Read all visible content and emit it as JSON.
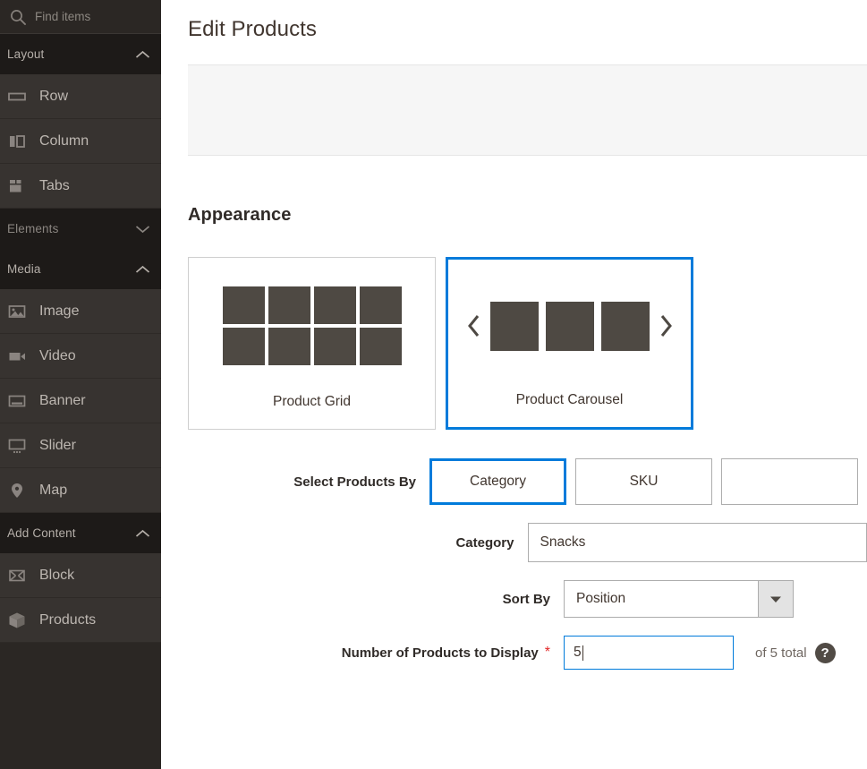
{
  "sidebar": {
    "search": {
      "placeholder": "Find items",
      "value": "",
      "icon": "search-icon"
    },
    "sections": [
      {
        "key": "layout",
        "label": "Layout",
        "expanded": true,
        "chevron": "chevron-up-icon",
        "items": [
          {
            "label": "Row",
            "icon": "row-icon"
          },
          {
            "label": "Column",
            "icon": "column-icon"
          },
          {
            "label": "Tabs",
            "icon": "tabs-icon"
          }
        ]
      },
      {
        "key": "elements",
        "label": "Elements",
        "expanded": false,
        "chevron": "chevron-down-icon",
        "items": []
      },
      {
        "key": "media",
        "label": "Media",
        "expanded": true,
        "chevron": "chevron-up-icon",
        "items": [
          {
            "label": "Image",
            "icon": "image-icon"
          },
          {
            "label": "Video",
            "icon": "video-icon"
          },
          {
            "label": "Banner",
            "icon": "banner-icon"
          },
          {
            "label": "Slider",
            "icon": "slider-icon"
          },
          {
            "label": "Map",
            "icon": "map-pin-icon"
          }
        ]
      },
      {
        "key": "add_content",
        "label": "Add Content",
        "expanded": true,
        "chevron": "chevron-up-icon",
        "items": [
          {
            "label": "Block",
            "icon": "block-icon"
          },
          {
            "label": "Products",
            "icon": "products-box-icon"
          }
        ]
      }
    ]
  },
  "main": {
    "page_title": "Edit Products",
    "appearance": {
      "title": "Appearance",
      "options": [
        {
          "label": "Product Grid",
          "art": "grid",
          "selected": false
        },
        {
          "label": "Product Carousel",
          "art": "carousel",
          "selected": true
        }
      ]
    },
    "form": {
      "select_products_by": {
        "label": "Select Products By",
        "options": [
          {
            "label": "Category",
            "selected": true
          },
          {
            "label": "SKU",
            "selected": false
          },
          {
            "label": "",
            "selected": false
          }
        ]
      },
      "category": {
        "label": "Category",
        "value": "Snacks",
        "placeholder": ""
      },
      "sort_by": {
        "label": "Sort By",
        "value": "Position",
        "arrow_icon": "chevron-down-icon"
      },
      "number_of_products": {
        "label": "Number of Products to Display",
        "required_mark": "*",
        "value": "5",
        "suffix_note": "of 5 total",
        "help_icon_glyph": "?"
      }
    }
  },
  "colors": {
    "accent_blue": "#007bdb",
    "sidebar_bg": "#2b2724",
    "sidebar_section_bg": "#1d1a18",
    "sidebar_item_bg": "#373330",
    "required_red": "#e22626",
    "art_gray": "#4e4943"
  }
}
